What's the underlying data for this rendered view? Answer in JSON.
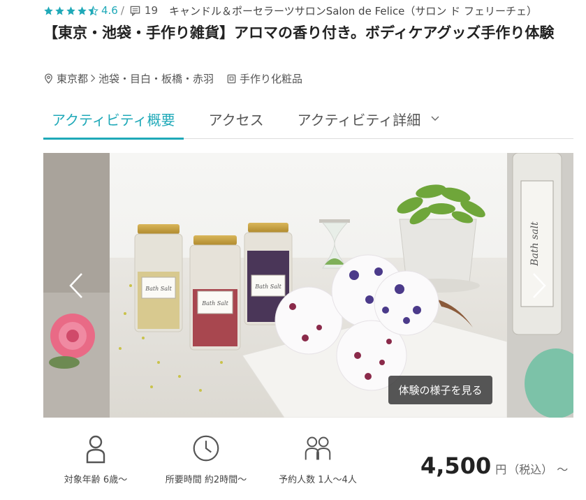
{
  "header": {
    "rating_value": "4.6",
    "rating_separator": "/",
    "review_count": "19",
    "shop_name": "キャンドル＆ポーセラーツサロンSalon de Felice（サロン ド フェリーチェ）",
    "stars_filled": 4.5,
    "accent_color": "#1fa9b8",
    "star_color": "#1fa9b8"
  },
  "title": "【東京・池袋・手作り雑貨】アロマの香り付き。ボディケアグッズ手作り体験",
  "meta": {
    "prefecture": "東京都",
    "area": "池袋・目白・板橋・赤羽",
    "category": "手作り化粧品"
  },
  "tabs": [
    {
      "label": "アクティビティ概要",
      "active": true
    },
    {
      "label": "アクセス",
      "active": false
    },
    {
      "label": "アクティビティ詳細",
      "active": false
    }
  ],
  "gallery": {
    "view_button": "体験の様子を見る",
    "jar_label": "Bath Salt",
    "side_label": "Bath salt"
  },
  "info": {
    "age_label": "対象年齢 6歳〜",
    "duration_label": "所要時間 約2時間〜",
    "people_label": "予約人数 1人〜4人"
  },
  "price": {
    "amount": "4,500",
    "unit": "円",
    "tax": "（税込）",
    "suffix": "〜"
  }
}
